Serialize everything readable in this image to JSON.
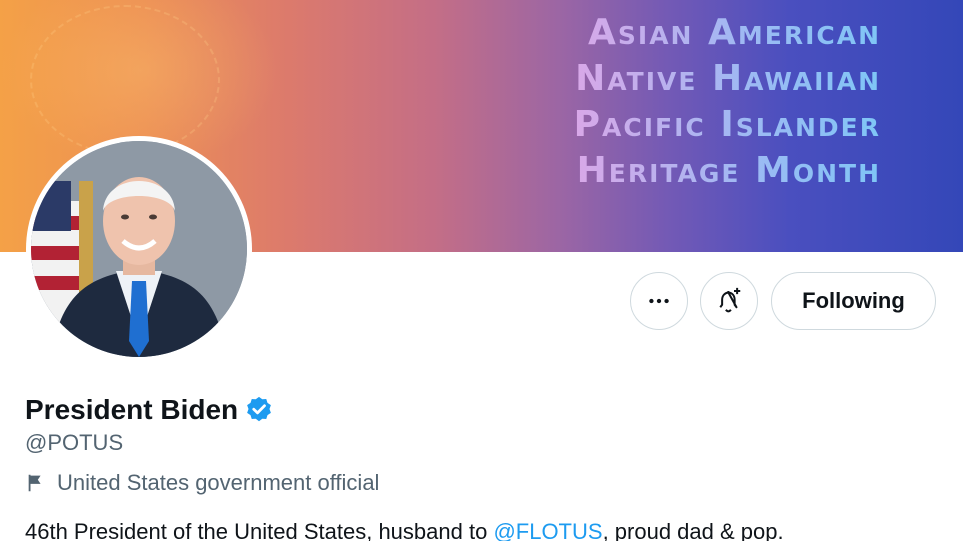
{
  "banner": {
    "lines": [
      "Asian American",
      "Native Hawaiian",
      "Pacific Islander",
      "Heritage Month"
    ]
  },
  "profile": {
    "display_name": "President Biden",
    "handle": "@POTUS",
    "label": "United States government official",
    "bio": {
      "before": "46th President of the United States, husband to ",
      "mention": "@FLOTUS",
      "after": ", proud dad & pop."
    }
  },
  "actions": {
    "more_icon": "more-horizontal-icon",
    "notify_icon": "bell-plus-icon",
    "following_label": "Following"
  },
  "colors": {
    "accent": "#1d9bf0",
    "secondary_text": "#536471",
    "primary_text": "#0f1419"
  }
}
